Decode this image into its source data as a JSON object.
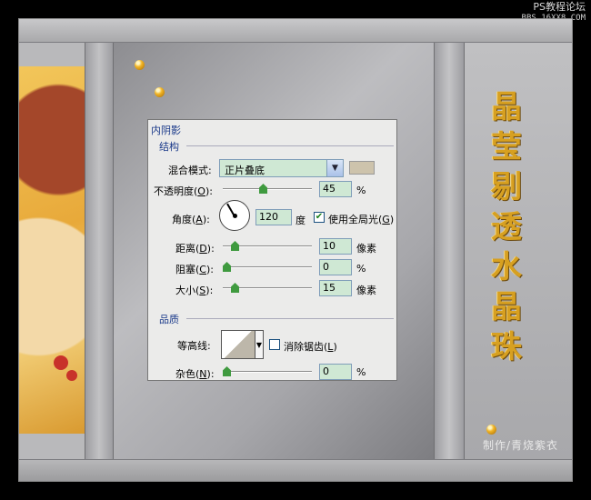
{
  "watermark": {
    "line1": "PS教程论坛",
    "line2": "BBS.16XX8.COM"
  },
  "title": {
    "chars": [
      "晶",
      "莹",
      "剔",
      "透",
      "水",
      "晶",
      "珠"
    ]
  },
  "credit": "制作/青烧紫衣",
  "dialog": {
    "header": "内阴影",
    "section_structure": "结构",
    "blend_mode_label": "混合模式:",
    "blend_mode_value": "正片叠底",
    "opacity_label": "不透明度(",
    "opacity_key": "O",
    "opacity_value": "45",
    "percent": "%",
    "angle_label": "角度(",
    "angle_key": "A",
    "angle_value": "120",
    "angle_unit": "度",
    "global_light_label": "使用全局光(",
    "global_light_key": "G",
    "global_light_checked": true,
    "distance_label": "距离(",
    "distance_key": "D",
    "distance_value": "10",
    "pixel_unit": "像素",
    "choke_label": "阻塞(",
    "choke_key": "C",
    "choke_value": "0",
    "size_label": "大小(",
    "size_key": "S",
    "size_value": "15",
    "section_quality": "品质",
    "contour_label": "等高线:",
    "antialias_label": "消除锯齿(",
    "antialias_key": "L",
    "antialias_checked": false,
    "noise_label": "杂色(",
    "noise_key": "N",
    "noise_value": "0",
    "close_paren": ")",
    "colon_close": "):"
  },
  "slider_levels": {
    "opacity": 0.45,
    "distance": 0.1,
    "choke": 0.0,
    "size": 0.1,
    "noise": 0.0
  },
  "colors": {
    "title_gold": "#d7a021",
    "field_bg": "#cfe8d4",
    "slider_thumb": "#3f9a3f",
    "shadow_swatch": "#cdc3ac"
  }
}
